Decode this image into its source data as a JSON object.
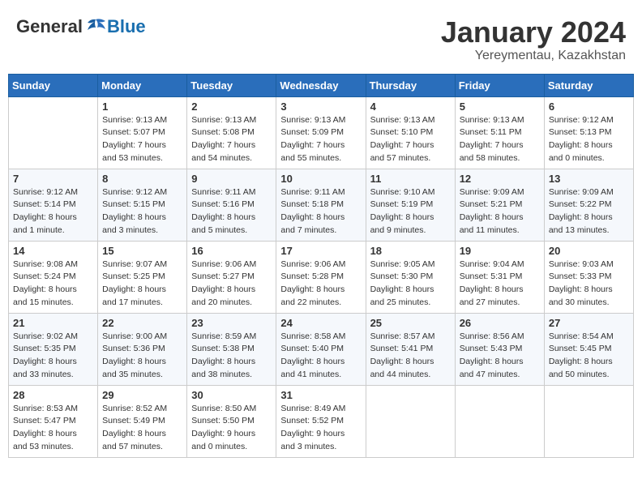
{
  "header": {
    "logo_general": "General",
    "logo_blue": "Blue",
    "month_title": "January 2024",
    "location": "Yereymentau, Kazakhstan"
  },
  "days_of_week": [
    "Sunday",
    "Monday",
    "Tuesday",
    "Wednesday",
    "Thursday",
    "Friday",
    "Saturday"
  ],
  "weeks": [
    [
      {
        "day": "",
        "info": ""
      },
      {
        "day": "1",
        "info": "Sunrise: 9:13 AM\nSunset: 5:07 PM\nDaylight: 7 hours\nand 53 minutes."
      },
      {
        "day": "2",
        "info": "Sunrise: 9:13 AM\nSunset: 5:08 PM\nDaylight: 7 hours\nand 54 minutes."
      },
      {
        "day": "3",
        "info": "Sunrise: 9:13 AM\nSunset: 5:09 PM\nDaylight: 7 hours\nand 55 minutes."
      },
      {
        "day": "4",
        "info": "Sunrise: 9:13 AM\nSunset: 5:10 PM\nDaylight: 7 hours\nand 57 minutes."
      },
      {
        "day": "5",
        "info": "Sunrise: 9:13 AM\nSunset: 5:11 PM\nDaylight: 7 hours\nand 58 minutes."
      },
      {
        "day": "6",
        "info": "Sunrise: 9:12 AM\nSunset: 5:13 PM\nDaylight: 8 hours\nand 0 minutes."
      }
    ],
    [
      {
        "day": "7",
        "info": "Sunrise: 9:12 AM\nSunset: 5:14 PM\nDaylight: 8 hours\nand 1 minute."
      },
      {
        "day": "8",
        "info": "Sunrise: 9:12 AM\nSunset: 5:15 PM\nDaylight: 8 hours\nand 3 minutes."
      },
      {
        "day": "9",
        "info": "Sunrise: 9:11 AM\nSunset: 5:16 PM\nDaylight: 8 hours\nand 5 minutes."
      },
      {
        "day": "10",
        "info": "Sunrise: 9:11 AM\nSunset: 5:18 PM\nDaylight: 8 hours\nand 7 minutes."
      },
      {
        "day": "11",
        "info": "Sunrise: 9:10 AM\nSunset: 5:19 PM\nDaylight: 8 hours\nand 9 minutes."
      },
      {
        "day": "12",
        "info": "Sunrise: 9:09 AM\nSunset: 5:21 PM\nDaylight: 8 hours\nand 11 minutes."
      },
      {
        "day": "13",
        "info": "Sunrise: 9:09 AM\nSunset: 5:22 PM\nDaylight: 8 hours\nand 13 minutes."
      }
    ],
    [
      {
        "day": "14",
        "info": "Sunrise: 9:08 AM\nSunset: 5:24 PM\nDaylight: 8 hours\nand 15 minutes."
      },
      {
        "day": "15",
        "info": "Sunrise: 9:07 AM\nSunset: 5:25 PM\nDaylight: 8 hours\nand 17 minutes."
      },
      {
        "day": "16",
        "info": "Sunrise: 9:06 AM\nSunset: 5:27 PM\nDaylight: 8 hours\nand 20 minutes."
      },
      {
        "day": "17",
        "info": "Sunrise: 9:06 AM\nSunset: 5:28 PM\nDaylight: 8 hours\nand 22 minutes."
      },
      {
        "day": "18",
        "info": "Sunrise: 9:05 AM\nSunset: 5:30 PM\nDaylight: 8 hours\nand 25 minutes."
      },
      {
        "day": "19",
        "info": "Sunrise: 9:04 AM\nSunset: 5:31 PM\nDaylight: 8 hours\nand 27 minutes."
      },
      {
        "day": "20",
        "info": "Sunrise: 9:03 AM\nSunset: 5:33 PM\nDaylight: 8 hours\nand 30 minutes."
      }
    ],
    [
      {
        "day": "21",
        "info": "Sunrise: 9:02 AM\nSunset: 5:35 PM\nDaylight: 8 hours\nand 33 minutes."
      },
      {
        "day": "22",
        "info": "Sunrise: 9:00 AM\nSunset: 5:36 PM\nDaylight: 8 hours\nand 35 minutes."
      },
      {
        "day": "23",
        "info": "Sunrise: 8:59 AM\nSunset: 5:38 PM\nDaylight: 8 hours\nand 38 minutes."
      },
      {
        "day": "24",
        "info": "Sunrise: 8:58 AM\nSunset: 5:40 PM\nDaylight: 8 hours\nand 41 minutes."
      },
      {
        "day": "25",
        "info": "Sunrise: 8:57 AM\nSunset: 5:41 PM\nDaylight: 8 hours\nand 44 minutes."
      },
      {
        "day": "26",
        "info": "Sunrise: 8:56 AM\nSunset: 5:43 PM\nDaylight: 8 hours\nand 47 minutes."
      },
      {
        "day": "27",
        "info": "Sunrise: 8:54 AM\nSunset: 5:45 PM\nDaylight: 8 hours\nand 50 minutes."
      }
    ],
    [
      {
        "day": "28",
        "info": "Sunrise: 8:53 AM\nSunset: 5:47 PM\nDaylight: 8 hours\nand 53 minutes."
      },
      {
        "day": "29",
        "info": "Sunrise: 8:52 AM\nSunset: 5:49 PM\nDaylight: 8 hours\nand 57 minutes."
      },
      {
        "day": "30",
        "info": "Sunrise: 8:50 AM\nSunset: 5:50 PM\nDaylight: 9 hours\nand 0 minutes."
      },
      {
        "day": "31",
        "info": "Sunrise: 8:49 AM\nSunset: 5:52 PM\nDaylight: 9 hours\nand 3 minutes."
      },
      {
        "day": "",
        "info": ""
      },
      {
        "day": "",
        "info": ""
      },
      {
        "day": "",
        "info": ""
      }
    ]
  ]
}
